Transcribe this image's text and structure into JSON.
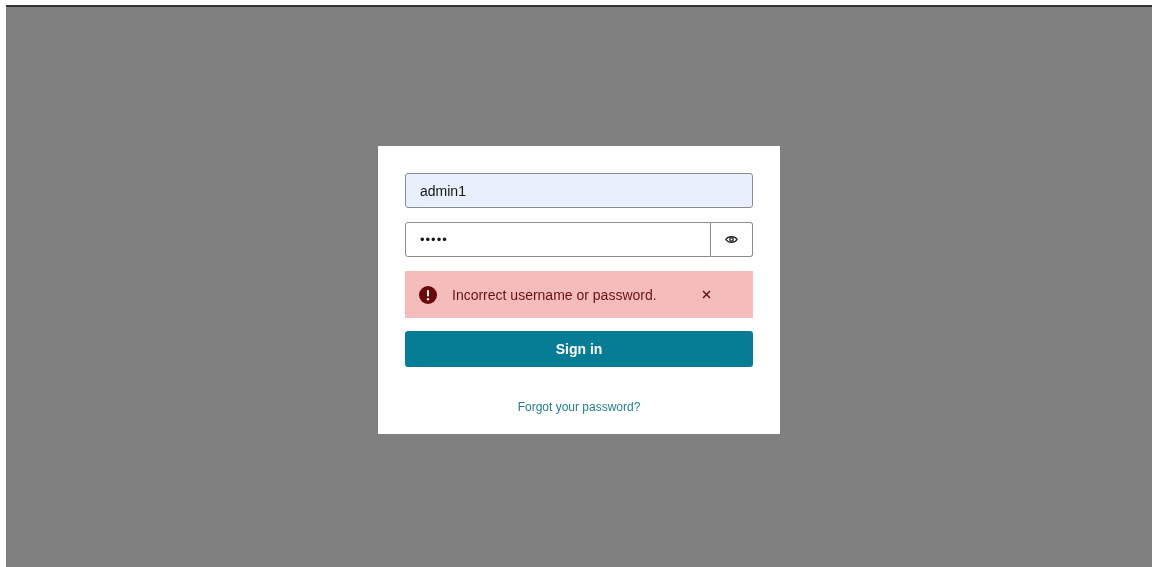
{
  "username": {
    "value": "admin1",
    "autofilled": true
  },
  "password": {
    "value": "•••••"
  },
  "alert": {
    "message": "Incorrect username or password."
  },
  "sign_in_button": {
    "label": "Sign in"
  },
  "forgot_link": {
    "label": "Forgot your password?"
  }
}
